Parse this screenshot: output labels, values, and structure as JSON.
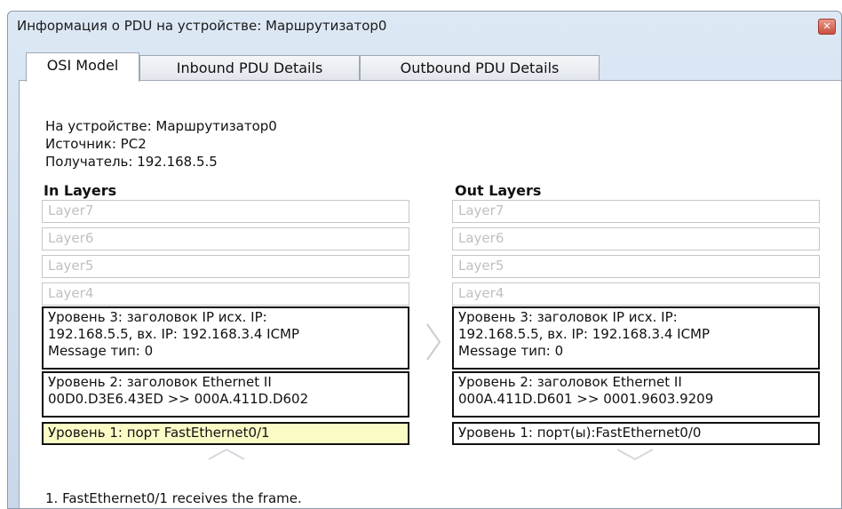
{
  "window": {
    "title": "Информация о PDU на устройстве: Маршрутизатор0"
  },
  "tabs": [
    "OSI Model",
    "Inbound PDU Details",
    "Outbound PDU Details"
  ],
  "info": {
    "device": "На устройстве: Маршрутизатор0",
    "source": "Источник: PC2",
    "destination": "Получатель: 192.168.5.5"
  },
  "in_layers": {
    "title": "In Layers",
    "layer7": "Layer7",
    "layer6": "Layer6",
    "layer5": "Layer5",
    "layer4": "Layer4",
    "layer3": [
      "Уровень 3: заголовок IP исх. IP:",
      "192.168.5.5, вх. IP: 192.168.3.4 ICMP",
      "Message тип: 0"
    ],
    "layer2": [
      "Уровень 2: заголовок Ethernet II",
      "00D0.D3E6.43ED >> 000A.411D.D602"
    ],
    "layer1": "Уровень 1: порт FastEthernet0/1"
  },
  "out_layers": {
    "title": "Out Layers",
    "layer7": "Layer7",
    "layer6": "Layer6",
    "layer5": "Layer5",
    "layer4": "Layer4",
    "layer3": [
      "Уровень 3: заголовок IP исх. IP:",
      "192.168.5.5, вх. IP: 192.168.3.4 ICMP",
      "Message тип: 0"
    ],
    "layer2": [
      "Уровень 2: заголовок Ethernet II",
      "000A.411D.D601 >> 0001.9603.9209"
    ],
    "layer1": "Уровень 1: порт(ы):FastEthernet0/0"
  },
  "description": "1. FastEthernet0/1 receives the frame.",
  "colors": {
    "highlight": "#fbfbc6",
    "close": "#c9503b"
  }
}
